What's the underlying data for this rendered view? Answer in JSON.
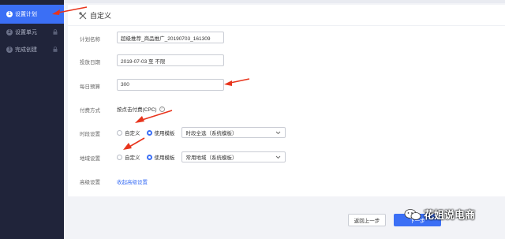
{
  "sidebar": {
    "items": [
      {
        "num": "1",
        "label": "设置计划",
        "active": true
      },
      {
        "num": "2",
        "label": "设置单元",
        "active": false
      },
      {
        "num": "3",
        "label": "完成创建",
        "active": false
      }
    ]
  },
  "panel": {
    "title": "自定义"
  },
  "form": {
    "plan_name_label": "计划名称",
    "plan_name_value": "超级推荐_商品推广_20190703_161309",
    "date_label": "投放日期",
    "date_value": "2019-07-03 至 不限",
    "budget_label": "每日预算",
    "budget_value": "300",
    "pay_label": "付费方式",
    "pay_value": "按点击付费(CPC)",
    "help_glyph": "?",
    "time_label": "时段设置",
    "time_option_custom": "自定义",
    "time_option_template": "使用模板",
    "time_select_value": "时段全选（系统模板）",
    "region_label": "地域设置",
    "region_option_custom": "自定义",
    "region_option_template": "使用模板",
    "region_select_value": "常用地域（系统模板）",
    "advanced_label": "高级设置",
    "advanced_link": "收起高级设置"
  },
  "footer": {
    "prev_label": "返回上一步",
    "next_label": "下一步"
  },
  "watermark": {
    "text": "花姐说电商"
  },
  "colors": {
    "accent": "#3b6ff5",
    "sidebar_bg": "#20243a",
    "arrow": "#e8341c"
  }
}
